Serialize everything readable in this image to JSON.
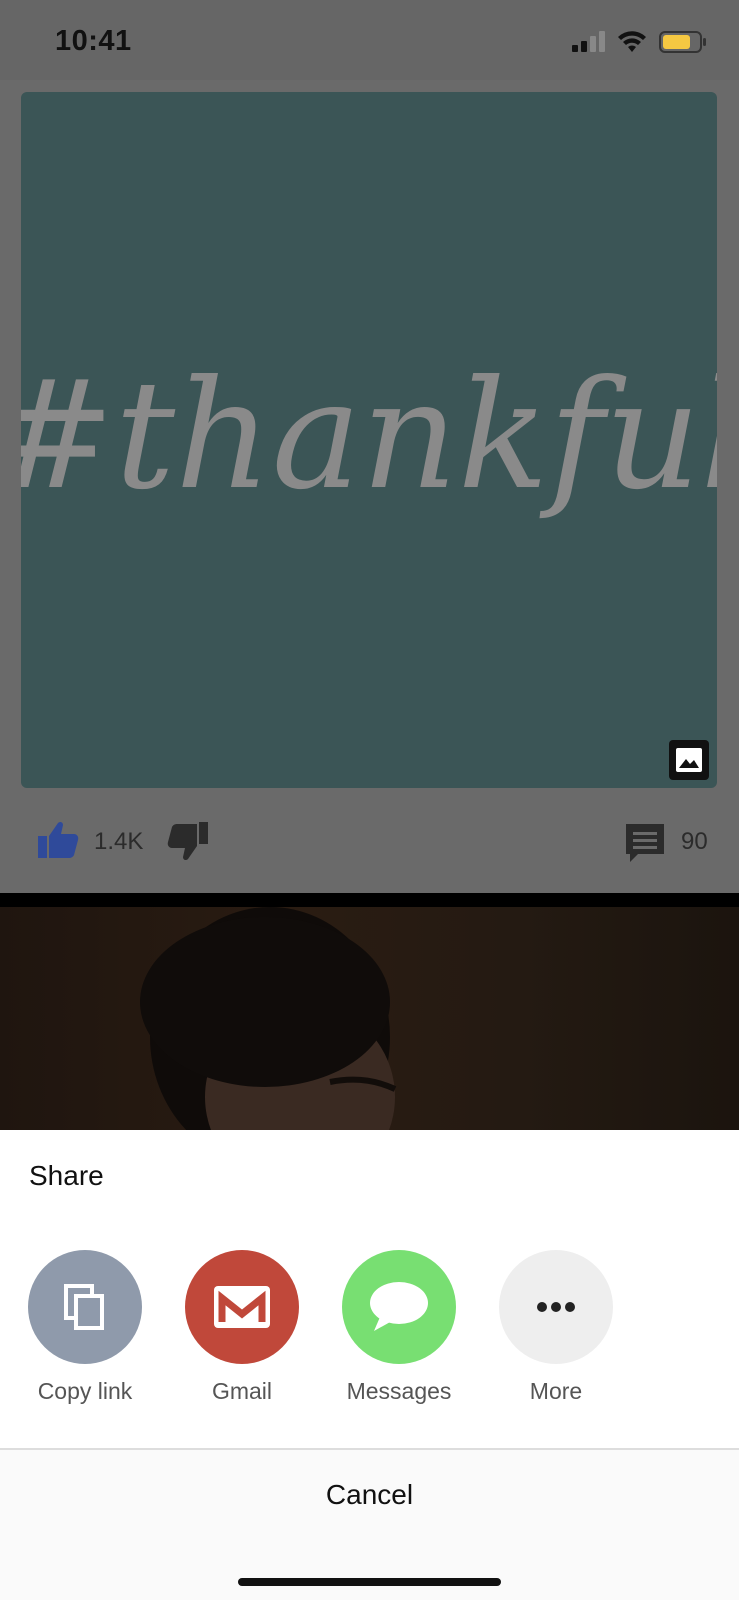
{
  "status_bar": {
    "time": "10:41",
    "battery_color": "#f5c842"
  },
  "post": {
    "image_text": "#thankful",
    "image_bg_color": "#3b5556",
    "likes": "1.4K",
    "comments": "90",
    "like_color": "#2f4a9a"
  },
  "share_sheet": {
    "title": "Share",
    "options": [
      {
        "label": "Copy link",
        "icon": "copy-icon",
        "color": "#8f9aab"
      },
      {
        "label": "Gmail",
        "icon": "gmail-icon",
        "color": "#c0483a"
      },
      {
        "label": "Messages",
        "icon": "messages-icon",
        "color": "#78df72"
      },
      {
        "label": "More",
        "icon": "more-dots-icon",
        "color": "#eeeeee"
      }
    ],
    "cancel_label": "Cancel"
  }
}
